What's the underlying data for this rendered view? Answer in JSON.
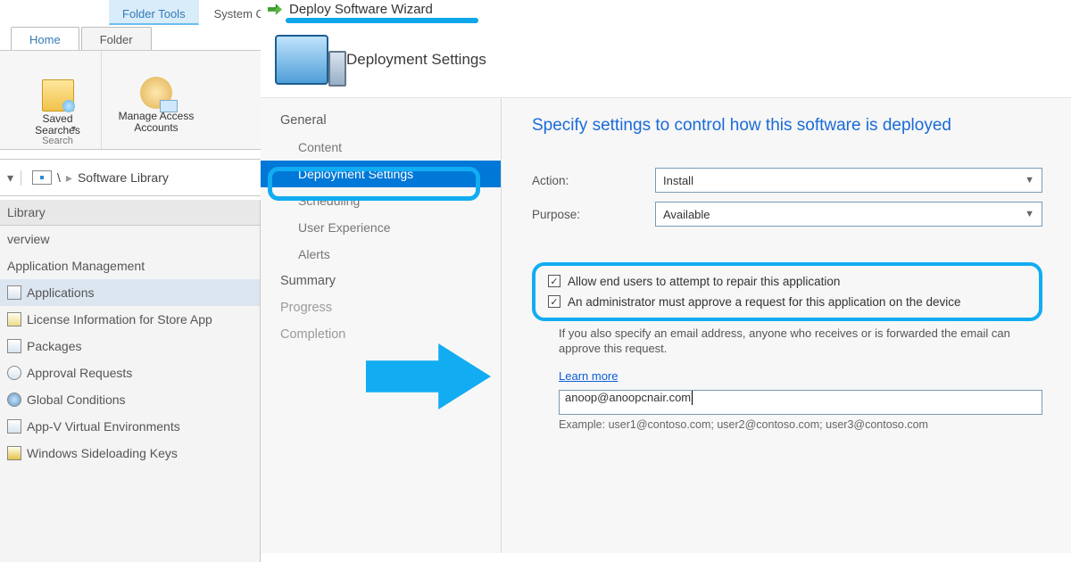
{
  "tabs": {
    "context": "Folder Tools",
    "system": "System C",
    "home": "Home",
    "folder": "Folder"
  },
  "ribbon": {
    "savedSearches": "Saved\nSearches",
    "manageAccess": "Manage Access\nAccounts",
    "groupLabel": "Search"
  },
  "breadcrumb": {
    "root": "\\",
    "library": "Software Library"
  },
  "leftPanel": {
    "header": "Library",
    "items": [
      "verview",
      "Application Management",
      "Applications",
      "License Information for Store App",
      "Packages",
      "Approval Requests",
      "Global Conditions",
      "App-V Virtual Environments",
      "Windows Sideloading Keys"
    ],
    "selectedIndex": 2
  },
  "wizard": {
    "title": "Deploy Software Wizard",
    "headerLabel": "Deployment Settings",
    "nav": {
      "general": "General",
      "content": "Content",
      "deploymentSettings": "Deployment Settings",
      "scheduling": "Scheduling",
      "userExperience": "User Experience",
      "alerts": "Alerts",
      "summary": "Summary",
      "progress": "Progress",
      "completion": "Completion"
    },
    "content": {
      "heading": "Specify settings to control how this software is deployed",
      "actionLabel": "Action:",
      "actionValue": "Install",
      "purposeLabel": "Purpose:",
      "purposeValue": "Available",
      "cb1": "Allow end users to attempt to repair this application",
      "cb2": "An administrator must approve a request for this application on the device",
      "hint": "If you also specify an email address, anyone who receives or is forwarded the email can approve this request.",
      "learnMore": "Learn more",
      "emailValue": "anoop@anoopcnair.com",
      "example": "Example: user1@contoso.com; user2@contoso.com; user3@contoso.com"
    }
  }
}
